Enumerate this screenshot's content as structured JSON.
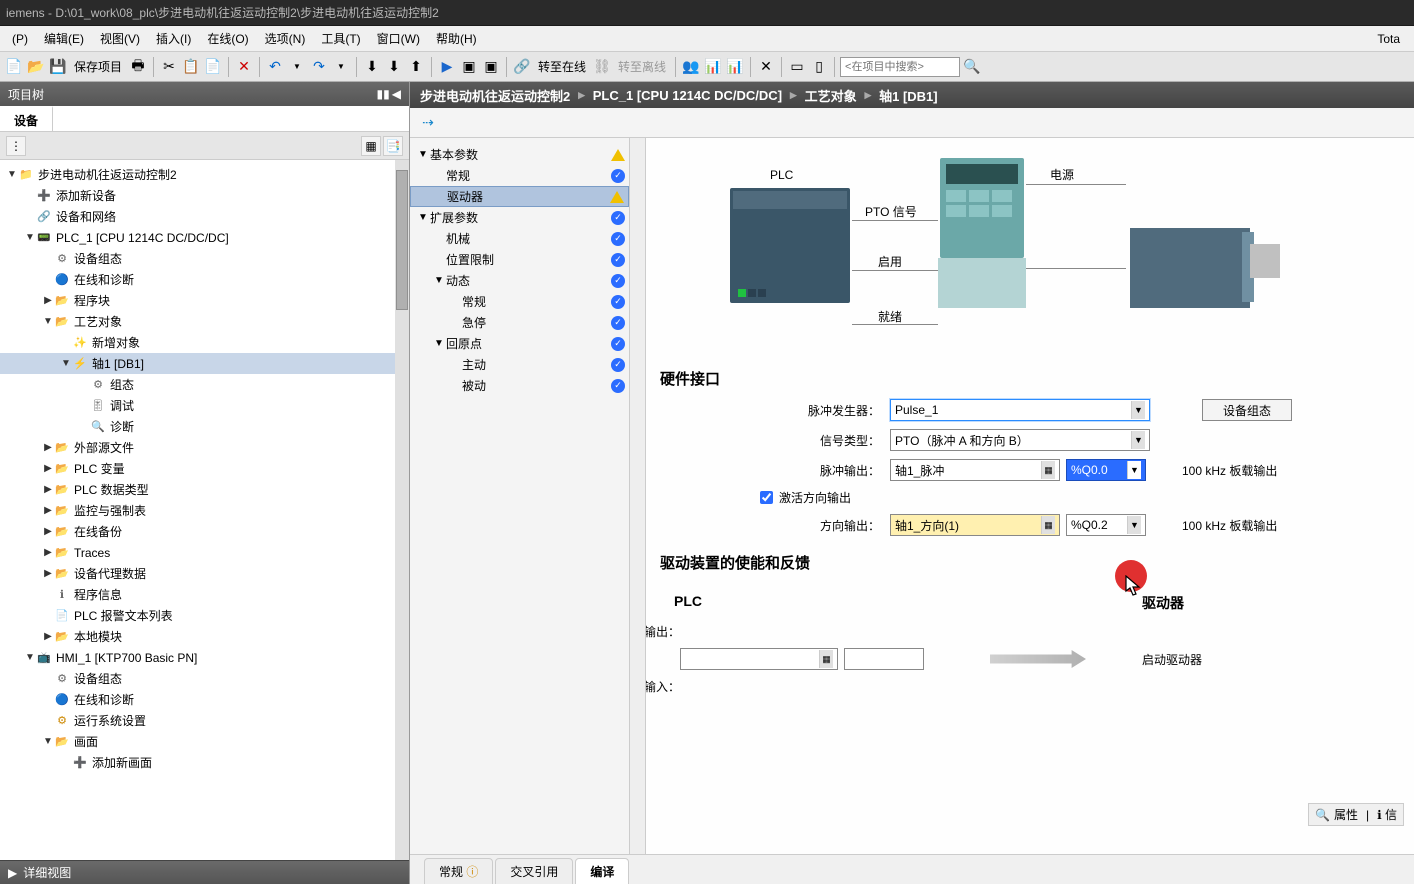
{
  "titlebar": "iemens  -  D:\\01_work\\08_plc\\步进电动机往返运动控制2\\步进电动机往返运动控制2",
  "menu": [
    "(P)",
    "编辑(E)",
    "视图(V)",
    "插入(I)",
    "在线(O)",
    "选项(N)",
    "工具(T)",
    "窗口(W)",
    "帮助(H)"
  ],
  "menu_right": "Tota",
  "toolbar": {
    "save": "保存项目",
    "online": "转至在线",
    "offline": "转至离线",
    "search_ph": "<在项目中搜索>"
  },
  "proj_tree": {
    "title": "项目树",
    "tab": "设备",
    "detail": "详细视图"
  },
  "tree": [
    {
      "d": 0,
      "a": "▼",
      "i": "📁",
      "t": "步进电动机往返运动控制2"
    },
    {
      "d": 1,
      "a": "",
      "i": "➕",
      "t": "添加新设备",
      "c": "#1a66cc"
    },
    {
      "d": 1,
      "a": "",
      "i": "🔗",
      "t": "设备和网络",
      "c": "#1a66cc"
    },
    {
      "d": 1,
      "a": "▼",
      "i": "📟",
      "t": "PLC_1 [CPU 1214C DC/DC/DC]",
      "c": "#1a66cc"
    },
    {
      "d": 2,
      "a": "",
      "i": "⚙",
      "t": "设备组态"
    },
    {
      "d": 2,
      "a": "",
      "i": "🔵",
      "t": "在线和诊断"
    },
    {
      "d": 2,
      "a": "▶",
      "i": "📂",
      "t": "程序块",
      "c": "#cc8800"
    },
    {
      "d": 2,
      "a": "▼",
      "i": "📂",
      "t": "工艺对象",
      "c": "#cc8800"
    },
    {
      "d": 3,
      "a": "",
      "i": "✨",
      "t": "新增对象"
    },
    {
      "d": 3,
      "a": "▼",
      "i": "⚡",
      "t": "轴1 [DB1]",
      "sel": true,
      "c": "#1a66cc"
    },
    {
      "d": 4,
      "a": "",
      "i": "⚙",
      "t": "组态"
    },
    {
      "d": 4,
      "a": "",
      "i": "🎚",
      "t": "调试"
    },
    {
      "d": 4,
      "a": "",
      "i": "🔍",
      "t": "诊断"
    },
    {
      "d": 2,
      "a": "▶",
      "i": "📂",
      "t": "外部源文件",
      "c": "#cc8800"
    },
    {
      "d": 2,
      "a": "▶",
      "i": "📂",
      "t": "PLC 变量",
      "c": "#cc8800"
    },
    {
      "d": 2,
      "a": "▶",
      "i": "📂",
      "t": "PLC 数据类型",
      "c": "#cc8800"
    },
    {
      "d": 2,
      "a": "▶",
      "i": "📂",
      "t": "监控与强制表",
      "c": "#cc8800"
    },
    {
      "d": 2,
      "a": "▶",
      "i": "📂",
      "t": "在线备份",
      "c": "#cc8800"
    },
    {
      "d": 2,
      "a": "▶",
      "i": "📂",
      "t": "Traces",
      "c": "#cc8800"
    },
    {
      "d": 2,
      "a": "▶",
      "i": "📂",
      "t": "设备代理数据",
      "c": "#cc8800"
    },
    {
      "d": 2,
      "a": "",
      "i": "ℹ",
      "t": "程序信息"
    },
    {
      "d": 2,
      "a": "",
      "i": "📄",
      "t": "PLC 报警文本列表"
    },
    {
      "d": 2,
      "a": "▶",
      "i": "📂",
      "t": "本地模块",
      "c": "#cc8800"
    },
    {
      "d": 1,
      "a": "▼",
      "i": "📺",
      "t": "HMI_1 [KTP700 Basic PN]",
      "c": "#1a66cc"
    },
    {
      "d": 2,
      "a": "",
      "i": "⚙",
      "t": "设备组态"
    },
    {
      "d": 2,
      "a": "",
      "i": "🔵",
      "t": "在线和诊断"
    },
    {
      "d": 2,
      "a": "",
      "i": "⚙",
      "t": "运行系统设置",
      "c": "#cc8800"
    },
    {
      "d": 2,
      "a": "▼",
      "i": "📂",
      "t": "画面",
      "c": "#cc8800"
    },
    {
      "d": 3,
      "a": "",
      "i": "➕",
      "t": "添加新画面",
      "c": "#1a66cc"
    }
  ],
  "breadcrumb": [
    "步进电动机往返运动控制2",
    "PLC_1 [CPU 1214C DC/DC/DC]",
    "工艺对象",
    "轴1 [DB1]"
  ],
  "nav": [
    {
      "d": 0,
      "a": "▼",
      "t": "基本参数",
      "s": "warn"
    },
    {
      "d": 1,
      "a": "",
      "t": "常规",
      "s": "ok"
    },
    {
      "d": 1,
      "a": "",
      "t": "驱动器",
      "s": "warn",
      "sel": true
    },
    {
      "d": 0,
      "a": "▼",
      "t": "扩展参数",
      "s": "ok"
    },
    {
      "d": 1,
      "a": "",
      "t": "机械",
      "s": "ok"
    },
    {
      "d": 1,
      "a": "",
      "t": "位置限制",
      "s": "ok"
    },
    {
      "d": 1,
      "a": "▼",
      "t": "动态",
      "s": "ok"
    },
    {
      "d": 2,
      "a": "",
      "t": "常规",
      "s": "ok"
    },
    {
      "d": 2,
      "a": "",
      "t": "急停",
      "s": "ok"
    },
    {
      "d": 1,
      "a": "▼",
      "t": "回原点",
      "s": "ok"
    },
    {
      "d": 2,
      "a": "",
      "t": "主动",
      "s": "ok"
    },
    {
      "d": 2,
      "a": "",
      "t": "被动",
      "s": "ok"
    }
  ],
  "diagram": {
    "plc": "PLC",
    "pto": "PTO 信号",
    "enable": "启用",
    "ready": "就绪",
    "power": "电源",
    "motor": "电机"
  },
  "hw": {
    "title": "硬件接口",
    "pulse_gen_lbl": "脉冲发生器：",
    "pulse_gen": "Pulse_1",
    "config_btn": "设备组态",
    "sig_type_lbl": "信号类型：",
    "sig_type": "PTO（脉冲 A 和方向 B）",
    "pulse_out_lbl": "脉冲输出：",
    "pulse_out": "轴1_脉冲",
    "pulse_addr": "%Q0.0",
    "pulse_note": "100 kHz 板载输出",
    "act_dir": "激活方向输出",
    "dir_out_lbl": "方向输出：",
    "dir_out": "轴1_方向(1)",
    "dir_addr": "%Q0.2",
    "dir_note": "100 kHz 板载输出"
  },
  "drive": {
    "title": "驱动装置的使能和反馈",
    "plc": "PLC",
    "driver": "驱动器",
    "enable_out": "使能输出：",
    "ready_in": "就绪输入：",
    "start": "启动驱动器"
  },
  "bottom_tabs": [
    "常规",
    "交叉引用",
    "编译"
  ],
  "status_right": [
    "属性",
    "信"
  ]
}
